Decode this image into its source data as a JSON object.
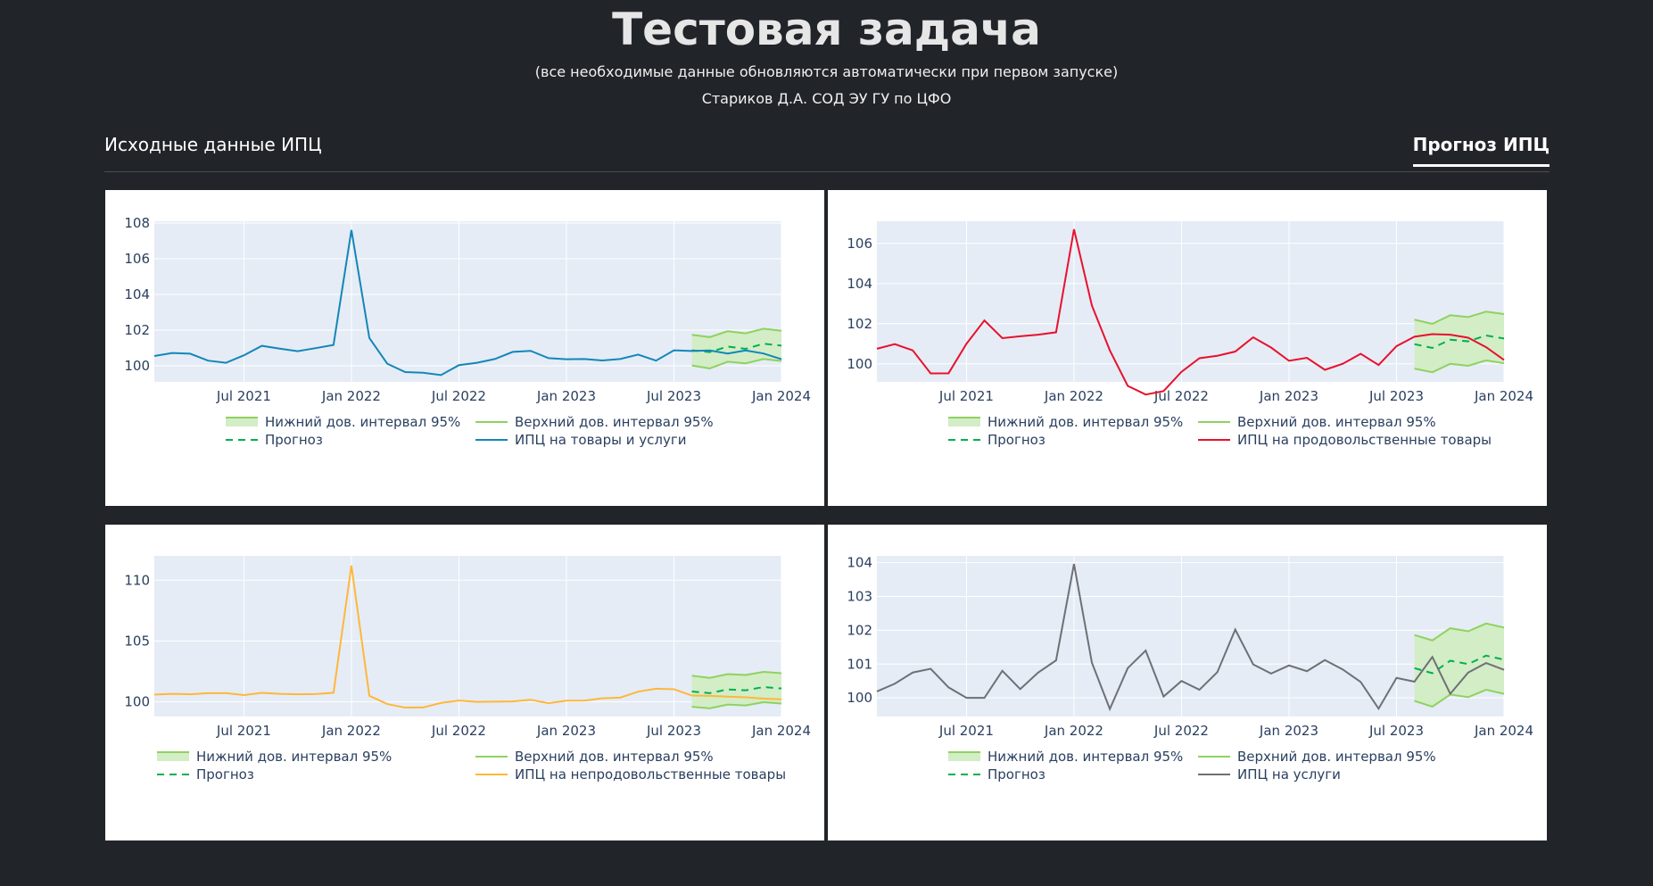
{
  "header": {
    "title": "Тестовая задача",
    "subtitle": "(все необходимые данные обновляются автоматически при первом запуске)",
    "author": "Стариков Д.А. СОД ЭУ ГУ по ЦФО"
  },
  "tabs": [
    {
      "label": "Исходные данные ИПЦ",
      "active": false
    },
    {
      "label": "Прогноз ИПЦ",
      "active": true
    }
  ],
  "colors": {
    "page_bg": "#212429",
    "plot_bg": "#e5ecf6",
    "band_fill": "#d3edc7",
    "band_line": "#8fd25f",
    "forecast": "#00b050",
    "series_all": "#1486b8",
    "series_food": "#e8112d",
    "series_nonfood": "#ffb739",
    "series_services": "#6e7075"
  },
  "legend_labels": {
    "lower": "Нижний дов. интервал 95%",
    "upper": "Верхний дов. интервал 95%",
    "forecast": "Прогноз"
  },
  "chart_data": [
    {
      "type": "line",
      "x_start": "2021-02",
      "x_ticks": [
        "Jul 2021",
        "Jan 2022",
        "Jul 2022",
        "Jan 2023",
        "Jul 2023",
        "Jan 2024"
      ],
      "ylim": [
        99.1,
        108.1
      ],
      "y_ticks": [
        100,
        102,
        104,
        106,
        108
      ],
      "series_name": "ИПЦ на товары и услуги",
      "series_color": "#1486b8",
      "values": [
        100.55,
        100.72,
        100.68,
        100.29,
        100.17,
        100.59,
        101.12,
        100.96,
        100.82,
        100.99,
        101.17,
        107.61,
        101.56,
        100.12,
        99.65,
        99.61,
        99.48,
        100.04,
        100.17,
        100.38,
        100.78,
        100.84,
        100.43,
        100.37,
        100.38,
        100.3,
        100.38,
        100.63,
        100.29,
        100.87,
        100.83,
        100.86,
        100.69,
        100.86,
        100.69,
        100.37
      ],
      "forecast_start": 30,
      "forecast": [
        100.87,
        100.77,
        101.08,
        100.95,
        101.24,
        101.13
      ],
      "lower": [
        100.02,
        99.85,
        100.23,
        100.14,
        100.38,
        100.27
      ],
      "upper": [
        101.74,
        101.61,
        101.94,
        101.82,
        102.08,
        101.96
      ]
    },
    {
      "type": "line",
      "x_start": "2021-02",
      "x_ticks": [
        "Jul 2021",
        "Jan 2022",
        "Jul 2022",
        "Jan 2023",
        "Jul 2023",
        "Jan 2024"
      ],
      "ylim": [
        99.1,
        107.1
      ],
      "y_ticks": [
        100,
        102,
        104,
        106
      ],
      "series_name": "ИПЦ на продовольственные товары",
      "series_color": "#e8112d",
      "values": [
        100.75,
        100.98,
        100.67,
        99.52,
        99.53,
        101.0,
        102.16,
        101.28,
        101.37,
        101.45,
        101.57,
        106.7,
        102.9,
        100.67,
        98.9,
        98.47,
        98.64,
        99.6,
        100.28,
        100.4,
        100.61,
        101.32,
        100.81,
        100.15,
        100.3,
        99.7,
        100.0,
        100.5,
        99.94,
        100.88,
        101.35,
        101.48,
        101.45,
        101.3,
        100.83,
        100.19
      ],
      "forecast_start": 30,
      "forecast": [
        100.98,
        100.79,
        101.2,
        101.12,
        101.41,
        101.26
      ],
      "lower": [
        99.76,
        99.58,
        100.0,
        99.9,
        100.17,
        100.03
      ],
      "upper": [
        102.2,
        101.99,
        102.42,
        102.33,
        102.6,
        102.48
      ]
    },
    {
      "type": "line",
      "x_start": "2021-02",
      "x_ticks": [
        "Jul 2021",
        "Jan 2022",
        "Jul 2022",
        "Jan 2023",
        "Jul 2023",
        "Jan 2024"
      ],
      "ylim": [
        98.8,
        112.0
      ],
      "y_ticks": [
        100,
        105,
        110
      ],
      "series_name": "ИПЦ на непродовольственные товары",
      "series_color": "#ffb739",
      "values": [
        100.6,
        100.66,
        100.62,
        100.72,
        100.72,
        100.56,
        100.74,
        100.66,
        100.62,
        100.64,
        100.75,
        111.2,
        100.5,
        99.82,
        99.53,
        99.54,
        99.92,
        100.11,
        100.0,
        100.02,
        100.04,
        100.17,
        99.89,
        100.1,
        100.1,
        100.29,
        100.35,
        100.84,
        101.08,
        101.04,
        100.52,
        100.5,
        100.43,
        100.38,
        100.27,
        100.21
      ],
      "forecast_start": 30,
      "forecast": [
        100.85,
        100.72,
        101.02,
        100.95,
        101.22,
        101.1
      ],
      "lower": [
        99.6,
        99.47,
        99.78,
        99.71,
        99.97,
        99.86
      ],
      "upper": [
        102.15,
        101.97,
        102.28,
        102.21,
        102.47,
        102.36
      ]
    },
    {
      "type": "line",
      "x_start": "2021-02",
      "x_ticks": [
        "Jul 2021",
        "Jan 2022",
        "Jul 2022",
        "Jan 2023",
        "Jul 2023",
        "Jan 2024"
      ],
      "ylim": [
        99.45,
        104.2
      ],
      "y_ticks": [
        100,
        101,
        102,
        103,
        104
      ],
      "series_name": "ИПЦ на услуги",
      "series_color": "#6e7075",
      "values": [
        100.19,
        100.42,
        100.75,
        100.86,
        100.31,
        100.0,
        100.0,
        100.8,
        100.26,
        100.75,
        101.11,
        103.96,
        101.04,
        99.67,
        100.88,
        101.4,
        100.04,
        100.5,
        100.24,
        100.76,
        102.02,
        100.99,
        100.72,
        100.96,
        100.79,
        101.12,
        100.84,
        100.47,
        99.68,
        100.59,
        100.48,
        101.21,
        100.12,
        100.75,
        101.03,
        100.83
      ],
      "forecast_start": 30,
      "forecast": [
        100.88,
        100.73,
        101.1,
        101.0,
        101.25,
        101.13
      ],
      "lower": [
        99.91,
        99.74,
        100.1,
        100.02,
        100.24,
        100.12
      ],
      "upper": [
        101.86,
        101.7,
        102.06,
        101.97,
        102.2,
        102.08
      ]
    }
  ]
}
